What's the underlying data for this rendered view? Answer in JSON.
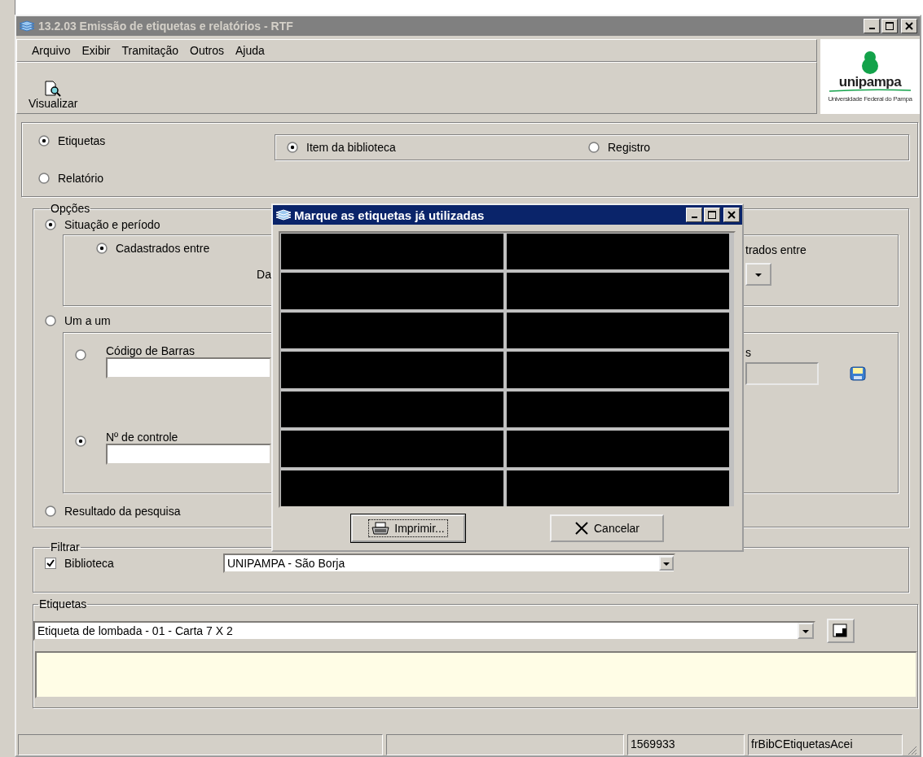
{
  "window": {
    "title": "13.2.03 Emissão de etiquetas e relatórios - RTF"
  },
  "menu": [
    {
      "label": "Arquivo"
    },
    {
      "label": "Exibir"
    },
    {
      "label": "Tramitação"
    },
    {
      "label": "Outros"
    },
    {
      "label": "Ajuda"
    }
  ],
  "toolbar": [
    {
      "label": "Visualizar"
    }
  ],
  "logo": {
    "name": "unipampa",
    "subtitle": "Universidade Federal do Pampa"
  },
  "output_type": [
    {
      "label": "Etiquetas",
      "selected": true
    },
    {
      "label": "Relatório",
      "selected": false
    }
  ],
  "source": [
    {
      "label": "Item da biblioteca",
      "selected": true
    },
    {
      "label": "Registro",
      "selected": false
    }
  ],
  "options": {
    "title": "Opções",
    "situation": {
      "label": "Situação e período",
      "selected": true,
      "registered": {
        "label": "Cadastrados entre",
        "selected": true
      },
      "from_label": "Da",
      "right_label": "trados entre"
    },
    "one_by_one": {
      "label": "Um a um",
      "selected": false,
      "barcode": {
        "label": "Código de Barras",
        "selected": false
      },
      "control": {
        "label": "Nº de controle",
        "selected": true
      },
      "right_label": "s"
    },
    "search_result": {
      "label": "Resultado da pesquisa",
      "selected": false
    }
  },
  "filter": {
    "title": "Filtrar",
    "library": {
      "label": "Biblioteca",
      "checked": true,
      "value": "UNIPAMPA - São Borja"
    }
  },
  "labels": {
    "title": "Etiquetas",
    "template": "Etiqueta de lombada - 01 - Carta 7 X 2"
  },
  "status_bar": [
    {
      "text": "1569933"
    },
    {
      "text": "frBibCEtiquetasAcei"
    }
  ],
  "dialog": {
    "title": "Marque as etiquetas já utilizadas",
    "grid": [
      {
        "cells": [
          {
            "kind": "label"
          },
          {
            "kind": "label"
          }
        ]
      },
      {
        "cells": [
          {
            "kind": "label"
          },
          {
            "kind": "label"
          }
        ]
      },
      {
        "cells": [
          {
            "kind": "label"
          },
          {
            "kind": "label"
          }
        ]
      },
      {
        "cells": [
          {
            "kind": "label"
          },
          {
            "kind": "label"
          }
        ]
      },
      {
        "cells": [
          {
            "kind": "label"
          },
          {
            "kind": "label"
          }
        ]
      },
      {
        "cells": [
          {
            "kind": "label"
          },
          {
            "kind": "label"
          }
        ]
      },
      {
        "cells": [
          {
            "kind": "label"
          },
          {
            "kind": "label"
          }
        ]
      }
    ],
    "buttons": [
      {
        "label": "Imprimir...",
        "kind": "print",
        "focused": true
      },
      {
        "label": "Cancelar",
        "kind": "cancel",
        "focused": false
      }
    ]
  }
}
